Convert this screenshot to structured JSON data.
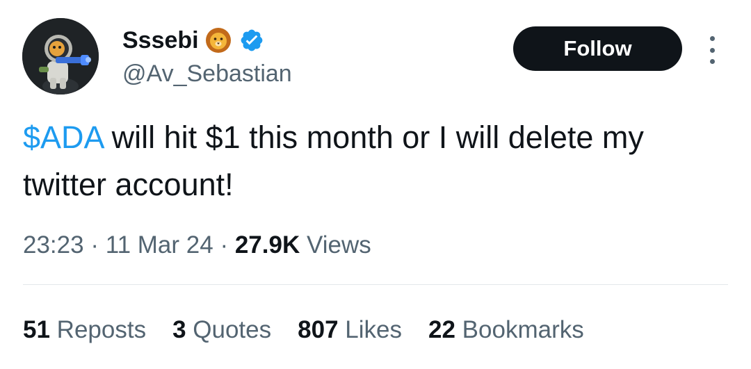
{
  "author": {
    "display_name": "Sssebi",
    "emoji_icon": "lion-face-icon",
    "verified_icon": "verified-badge-icon",
    "handle": "@Av_Sebastian"
  },
  "follow_label": "Follow",
  "more_icon": "more-vertical-icon",
  "tweet": {
    "cashtag": "$ADA",
    "text_rest": " will hit $1 this month or I will delete my twitter account!"
  },
  "meta": {
    "time": "23:23",
    "separator": "·",
    "date": "11 Mar 24",
    "views_count": "27.9K",
    "views_label": "Views"
  },
  "stats": [
    {
      "count": "51",
      "label": "Reposts"
    },
    {
      "count": "3",
      "label": "Quotes"
    },
    {
      "count": "807",
      "label": "Likes"
    },
    {
      "count": "22",
      "label": "Bookmarks"
    }
  ],
  "colors": {
    "link": "#1d9bf0",
    "text": "#0f1419",
    "muted": "#536471",
    "button": "#0f1419"
  }
}
